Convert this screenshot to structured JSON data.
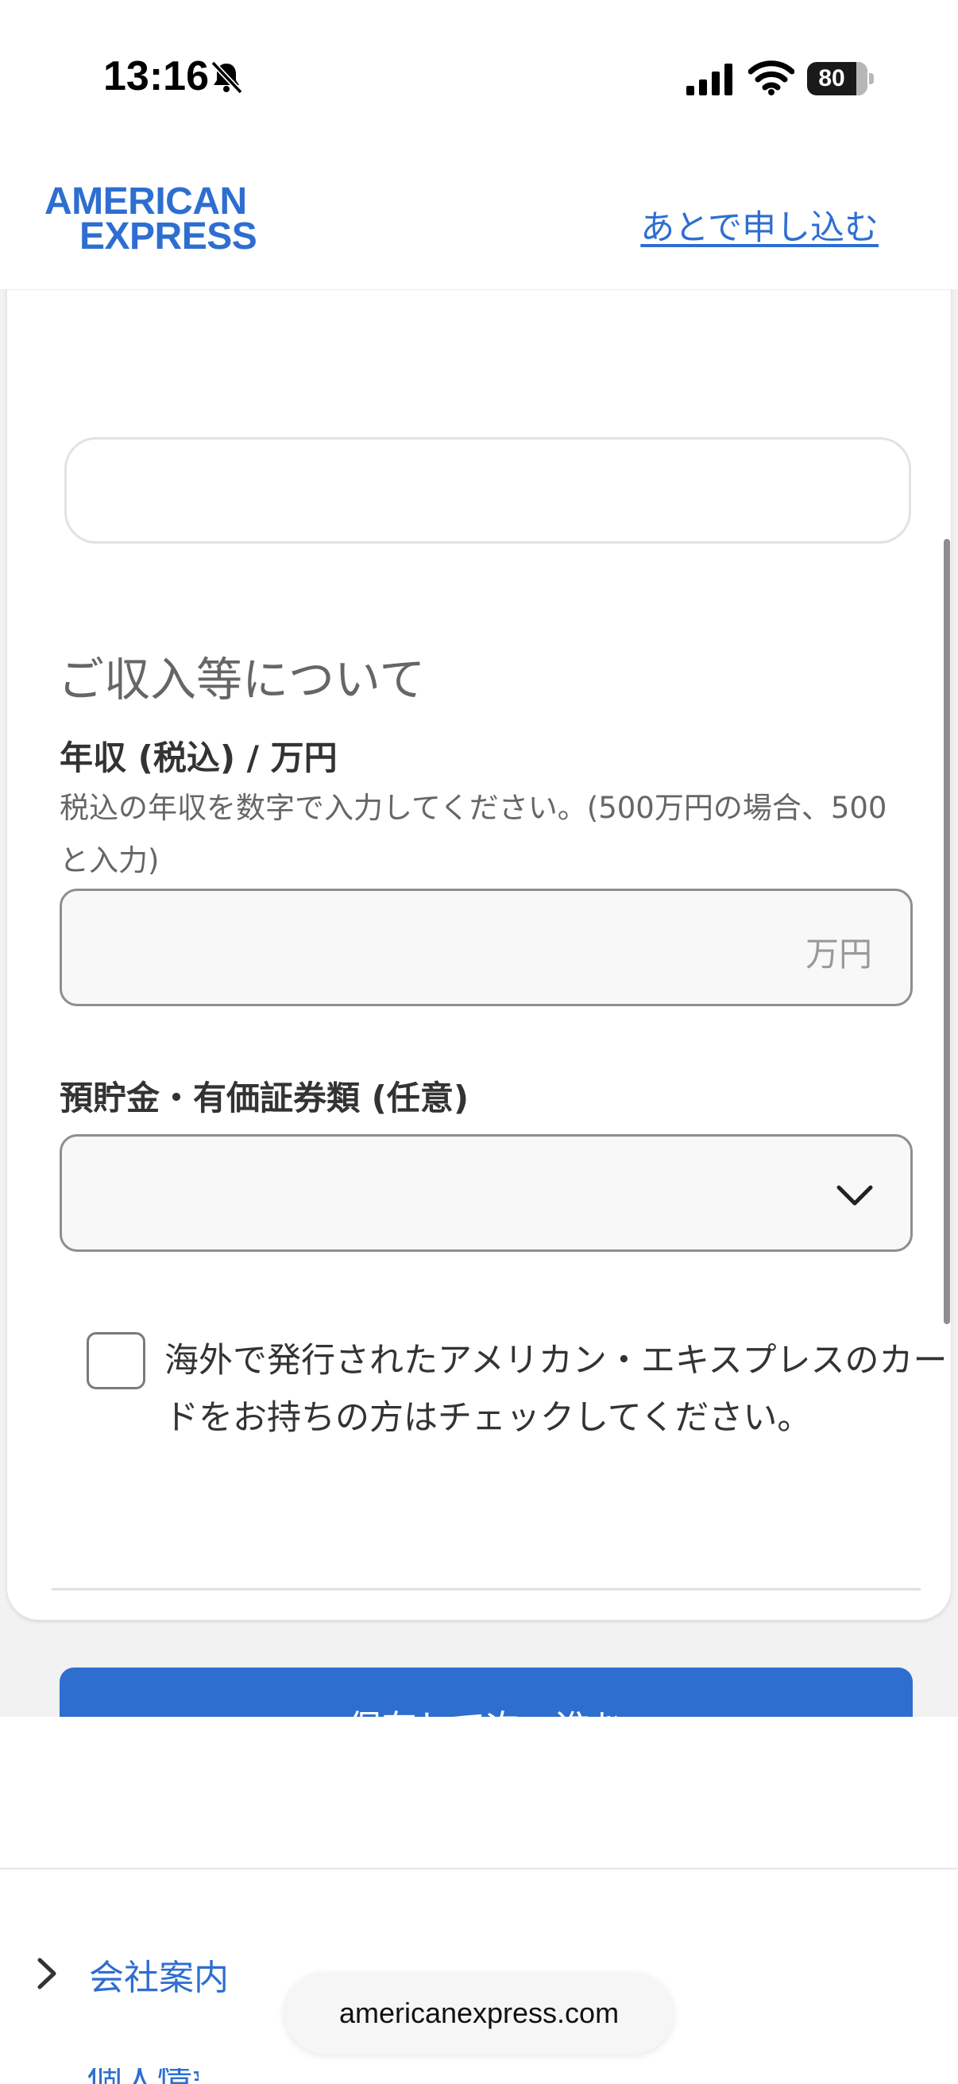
{
  "status_bar": {
    "time": "13:16",
    "battery_percent": "80",
    "icons": [
      "bell-slash-icon",
      "cellular-signal-icon",
      "wifi-icon",
      "battery-icon"
    ]
  },
  "header": {
    "logo_line1": "AMERICAN",
    "logo_line2": "EXPRESS",
    "apply_later_link": "あとで申し込む"
  },
  "form": {
    "section_title": "ご収入等について",
    "income": {
      "label": "年収 (税込) / 万円",
      "help": "税込の年収を数字で入力してください。(500万円の場合、500と入力)",
      "value": "",
      "unit": "万円"
    },
    "savings": {
      "label": "預貯金・有価証券類 (任意)",
      "selected": ""
    },
    "overseas_card_checkbox": {
      "checked": false,
      "label": "海外で発行されたアメリカン・エキスプレスのカードをお持ちの方はチェックしてください。"
    },
    "submit_button": "保存して次へ進む"
  },
  "footer": {
    "company_link": "会社案内",
    "next_link": "個人情報"
  },
  "browser": {
    "url": "americanexpress.com"
  },
  "colors": {
    "brand_blue": "#2E6ED0",
    "page_background": "#F2F2F2",
    "input_background": "#F8F8F8"
  }
}
